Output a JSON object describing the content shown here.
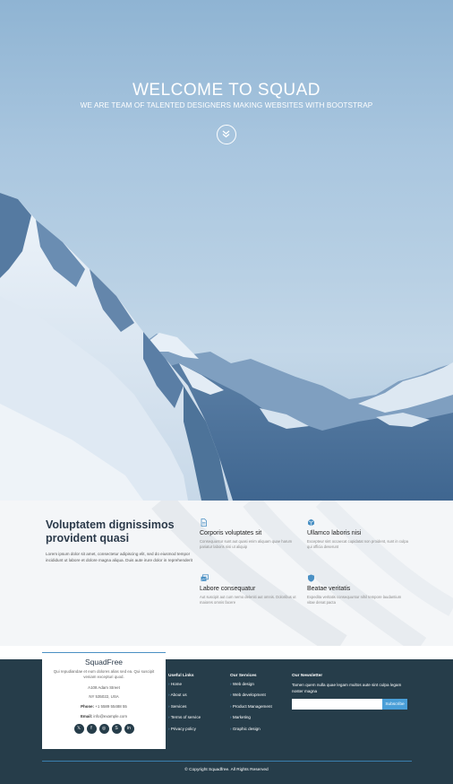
{
  "hero": {
    "title": "WELCOME TO SQUAD",
    "subtitle": "WE ARE TEAM OF TALENTED DESIGNERS MAKING WEBSITES WITH BOOTSTRAP",
    "scroll_icon": "double-chevron-down-icon"
  },
  "features": {
    "title": "Voluptatem dignissimos provident quasi",
    "description": "Lorem ipsum dolor sit amet, consectetur adipiscing elit, sed do eiusmod tempor incididunt ut labore et dolore magna aliqua. Duis aute irure dolor in reprehenderit",
    "cards": [
      {
        "icon": "document-icon",
        "title": "Corporis voluptates sit",
        "text": "Consequuntur sunt aut quasi enim aliquam quae harum pariatur laboris nisi ut aliquip"
      },
      {
        "icon": "box-icon",
        "title": "Ullamco laboris nisi",
        "text": "Excepteur sint occaecat cupidatat non proident, sunt in culpa qui officia deserunt"
      },
      {
        "icon": "images-icon",
        "title": "Labore consequatur",
        "text": "Aut suscipit aut cum nemo deleniti aut omnis. Doloribus ut maiores omnis facere"
      },
      {
        "icon": "shield-icon",
        "title": "Beatae veritatis",
        "text": "Expedita veritatis consequuntur nihil tempore laudantium vitae denat pacta"
      }
    ],
    "accent": "#4a90c4"
  },
  "footer": {
    "brand": {
      "name": "SquadFree",
      "tagline": "Qui repudiandae et eum dolores alias sed ea. Qui suscipit veniam excepturi quod.",
      "address1": "A108 Adam Street",
      "address2": "NY 535022, USA",
      "phone_label": "Phone:",
      "phone": "+1 5589 55488 55",
      "email_label": "Email:",
      "email": "info@example.com",
      "socials": [
        "x-icon",
        "facebook-icon",
        "instagram-icon",
        "skype-icon",
        "linkedin-icon"
      ]
    },
    "useful_links": {
      "heading": "Useful Links",
      "items": [
        "Home",
        "About us",
        "Services",
        "Terms of service",
        "Privacy policy"
      ]
    },
    "services": {
      "heading": "Our Services",
      "items": [
        "Web design",
        "Web development",
        "Product Management",
        "Marketing",
        "Graphic design"
      ]
    },
    "newsletter": {
      "heading": "Our Newsletter",
      "text": "Tamen quem nulla quae legam multos aute sint culpa legam noster magna",
      "placeholder": "",
      "button": "Subscribe"
    },
    "copyright": "© Copyright Squadfree. All Rights Reserved",
    "bg": "#263d4a"
  }
}
